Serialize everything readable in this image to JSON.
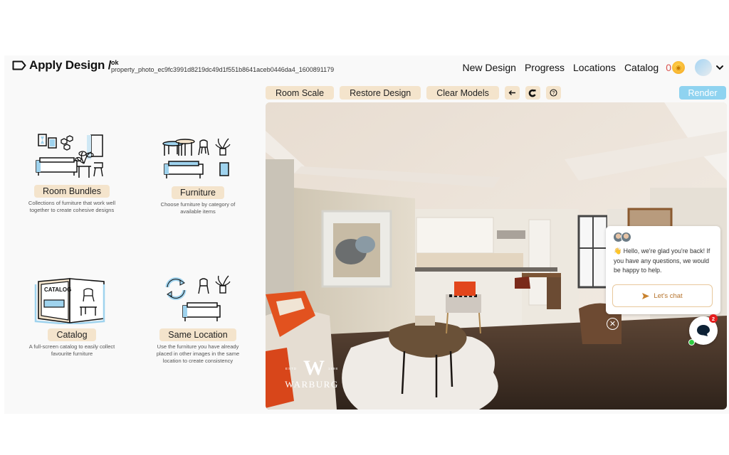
{
  "header": {
    "title": "Apply Design /",
    "breadcrumb_top": "ok",
    "breadcrumb_bottom": "property_photo_ec9fc3991d8219dc49d1f551b8641aceb0446da4_1600891179",
    "nav": [
      "New Design",
      "Progress",
      "Locations",
      "Catalog"
    ],
    "coin_count": "0",
    "icons": {
      "logo": "tag-outline-icon",
      "coin": "coin-icon",
      "avatar": "user-avatar",
      "menu": "chevron-down-icon"
    }
  },
  "toolbar": {
    "buttons": [
      "Room Scale",
      "Restore Design",
      "Clear Models"
    ],
    "icon_buttons": [
      {
        "name": "undo-arrow-icon",
        "glyph": "↩"
      },
      {
        "name": "magnet-icon",
        "glyph": "⟲"
      },
      {
        "name": "help-icon",
        "glyph": "?"
      }
    ],
    "render_label": "Render"
  },
  "options": [
    {
      "label": "Room Bundles",
      "desc": "Collections of furniture that work well together to create cohesive designs"
    },
    {
      "label": "Furniture",
      "desc": "Choose furniture by category of available items"
    },
    {
      "label": "Catalog",
      "desc": "A full-screen catalog to easily collect favourite furniture"
    },
    {
      "label": "Same Location",
      "desc": "Use the furniture you have already placed in other images in the same location to create consistency"
    }
  ],
  "photo": {
    "watermark_mark": "W",
    "watermark_estd_left": "ESTD",
    "watermark_estd_right": "1898",
    "watermark_name": "WARBURG",
    "catalog_illustration_text": "CATALOG"
  },
  "chat": {
    "wave": "👋",
    "message": "Hello, we're glad you're back! If you have any questions, we would be happy to help.",
    "cta": "Let's chat",
    "close": "✕",
    "unread_count": "2"
  },
  "colors": {
    "accent_beige": "#f4e4cc",
    "render_blue": "#8fd3f0",
    "coin_red": "#d9534f",
    "chat_cta": "#b5722a",
    "badge_red": "#e51d1d",
    "online_green": "#2ecc40"
  }
}
